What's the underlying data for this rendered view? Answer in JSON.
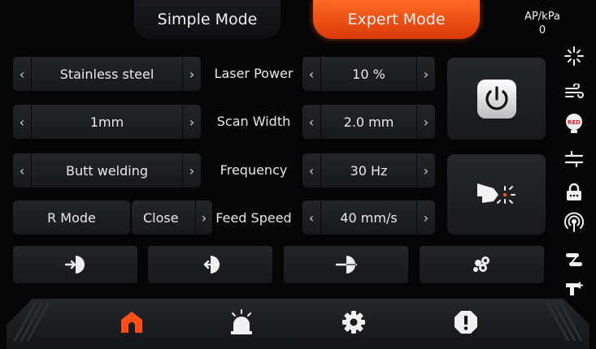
{
  "tabs": {
    "simple": "Simple Mode",
    "expert": "Expert Mode"
  },
  "readout": {
    "unit": "AP/kPa",
    "value": "0"
  },
  "left_selectors": [
    {
      "value": "Stainless steel"
    },
    {
      "value": "1mm"
    },
    {
      "value": "Butt welding"
    }
  ],
  "r_mode": {
    "label": "R Mode",
    "value": "Close"
  },
  "params": [
    {
      "label": "Laser Power",
      "value": "10 %"
    },
    {
      "label": "Scan Width",
      "value": "2.0 mm"
    },
    {
      "label": "Frequency",
      "value": "30 Hz"
    },
    {
      "label": "Feed Speed",
      "value": "40 mm/s"
    }
  ],
  "arrows": {
    "left": "‹",
    "right": "›"
  },
  "icons": {
    "power": "power-icon",
    "laser_head": "laser-head-icon",
    "side": [
      "sparkle-icon",
      "air-flow-icon",
      "red-light-icon",
      "wire-feed-icon",
      "lock-icon",
      "wireless-icon",
      "cable-icon",
      "welding-gun-icon"
    ],
    "tools": [
      "wire-in-icon",
      "wire-out-icon",
      "wire-cut-icon",
      "gas-blow-icon"
    ],
    "nav": [
      "home-icon",
      "alarm-icon",
      "settings-icon",
      "warning-icon"
    ],
    "red_badge": "RED"
  },
  "colors": {
    "accent": "#ff5a1e",
    "background": "#050506",
    "button": "#1f2124"
  }
}
